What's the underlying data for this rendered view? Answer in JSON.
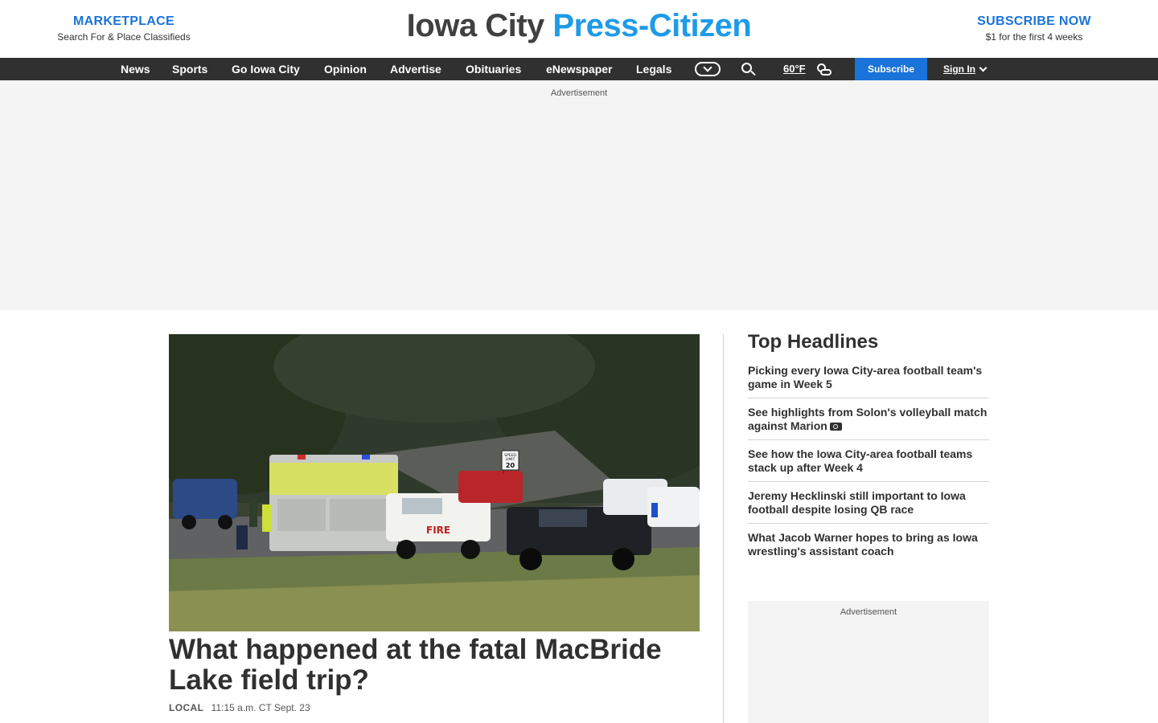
{
  "header": {
    "marketplace_title": "MARKETPLACE",
    "marketplace_subtitle": "Search For & Place Classifieds",
    "logo_part1": "Iowa City",
    "logo_part2": "Press-Citizen",
    "subscribe_title": "SUBSCRIBE NOW",
    "subscribe_subtitle": "$1 for the first 4 weeks"
  },
  "nav": {
    "items": [
      "News",
      "Sports",
      "Go Iowa City",
      "Opinion",
      "Advertise",
      "Obituaries",
      "eNewspaper",
      "Legals"
    ],
    "weather": "60°F",
    "subscribe_button": "Subscribe",
    "signin": "Sign In",
    "icons": [
      "globe-dropdown-icon",
      "search-icon",
      "partly-cloudy-night-icon",
      "chevron-down-icon"
    ]
  },
  "ads": {
    "label": "Advertisement"
  },
  "hero": {
    "title": "What happened at the fatal MacBride Lake field trip?",
    "section": "LOCAL",
    "timestamp": "11:15 a.m. CT Sept. 23",
    "photo_signs": {
      "sign_text_a": "SPEED",
      "sign_text_b": "LIMIT",
      "sign_value": "20",
      "truck_text": "FIRE"
    }
  },
  "top_headlines": {
    "title": "Top Headlines",
    "items": [
      "Picking every Iowa City-area football team's game in Week 5",
      "See highlights from Solon's volleyball match against Marion",
      "See how the Iowa City-area football teams stack up after Week 4",
      "Jeremy Hecklinski still important to Iowa football despite losing QB race",
      "What Jacob Warner hopes to bring as Iowa wrestling's assistant coach"
    ]
  },
  "colors": {
    "accent": "#1a73d9",
    "logo_blue": "#1e9be8",
    "nav_bg": "#303030",
    "ad_bg": "#f4f4f4"
  }
}
